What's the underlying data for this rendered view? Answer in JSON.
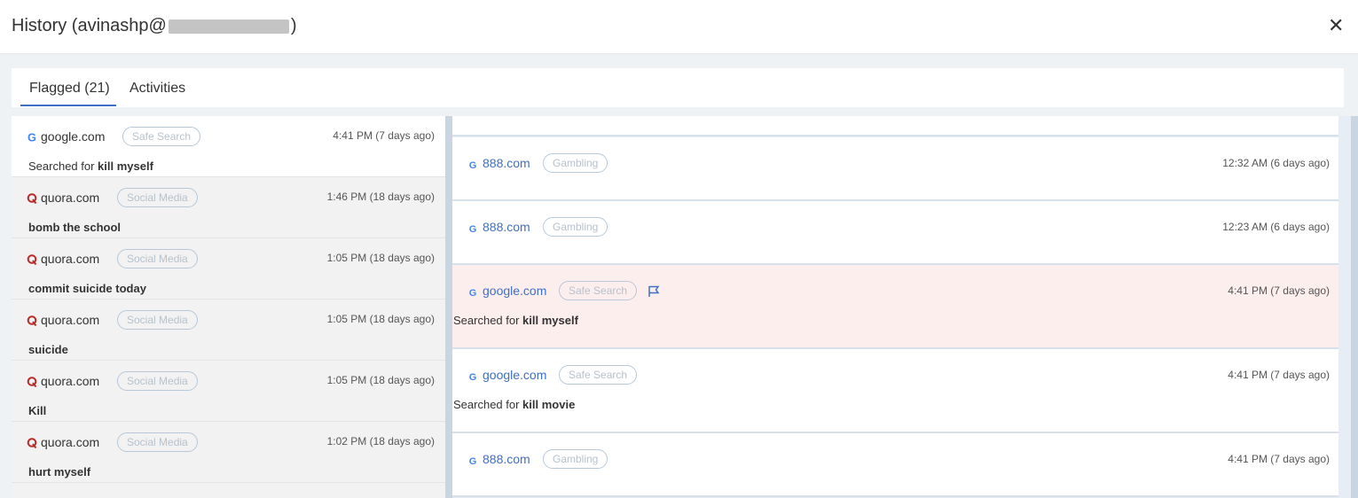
{
  "header": {
    "title_prefix": "History (avinashp@",
    "title_suffix": ")",
    "close_label": "✕"
  },
  "tabs": [
    {
      "label": "Flagged (21)"
    },
    {
      "label": "Activities"
    }
  ],
  "colors": {
    "accent": "#3f6fc6",
    "flag_bg": "#fdeeee",
    "quora": "#b92b27"
  },
  "left_list": [
    {
      "site": "google.com",
      "icon": "google-icon",
      "category": "Safe Search",
      "time": "4:41 PM (7 days ago)",
      "query_prefix": "Searched for ",
      "query_bold": "kill myself"
    },
    {
      "site": "quora.com",
      "icon": "quora-icon",
      "category": "Social Media",
      "time": "1:46 PM (18 days ago)",
      "query_prefix": "",
      "query_bold": "bomb the school"
    },
    {
      "site": "quora.com",
      "icon": "quora-icon",
      "category": "Social Media",
      "time": "1:05 PM (18 days ago)",
      "query_prefix": "",
      "query_bold": "commit suicide today"
    },
    {
      "site": "quora.com",
      "icon": "quora-icon",
      "category": "Social Media",
      "time": "1:05 PM (18 days ago)",
      "query_prefix": "",
      "query_bold": "suicide"
    },
    {
      "site": "quora.com",
      "icon": "quora-icon",
      "category": "Social Media",
      "time": "1:05 PM (18 days ago)",
      "query_prefix": "",
      "query_bold": "Kill"
    },
    {
      "site": "quora.com",
      "icon": "quora-icon",
      "category": "Social Media",
      "time": "1:02 PM (18 days ago)",
      "query_prefix": "",
      "query_bold": "hurt myself"
    }
  ],
  "activity_list": [
    {
      "site": "888.com",
      "icon": "google-icon",
      "category": "Gambling",
      "time": "12:32 AM (6 days ago)",
      "query_prefix": "",
      "query_bold": ""
    },
    {
      "site": "888.com",
      "icon": "google-icon",
      "category": "Gambling",
      "time": "12:23 AM (6 days ago)",
      "query_prefix": "",
      "query_bold": ""
    },
    {
      "site": "google.com",
      "icon": "google-icon",
      "category": "Safe Search",
      "time": "4:41 PM (7 days ago)",
      "query_prefix": "Searched for ",
      "query_bold": "kill myself",
      "flagged": true
    },
    {
      "site": "google.com",
      "icon": "google-icon",
      "category": "Safe Search",
      "time": "4:41 PM (7 days ago)",
      "query_prefix": "Searched for ",
      "query_bold": "kill movie"
    },
    {
      "site": "888.com",
      "icon": "google-icon",
      "category": "Gambling",
      "time": "4:41 PM (7 days ago)",
      "query_prefix": "",
      "query_bold": ""
    }
  ]
}
